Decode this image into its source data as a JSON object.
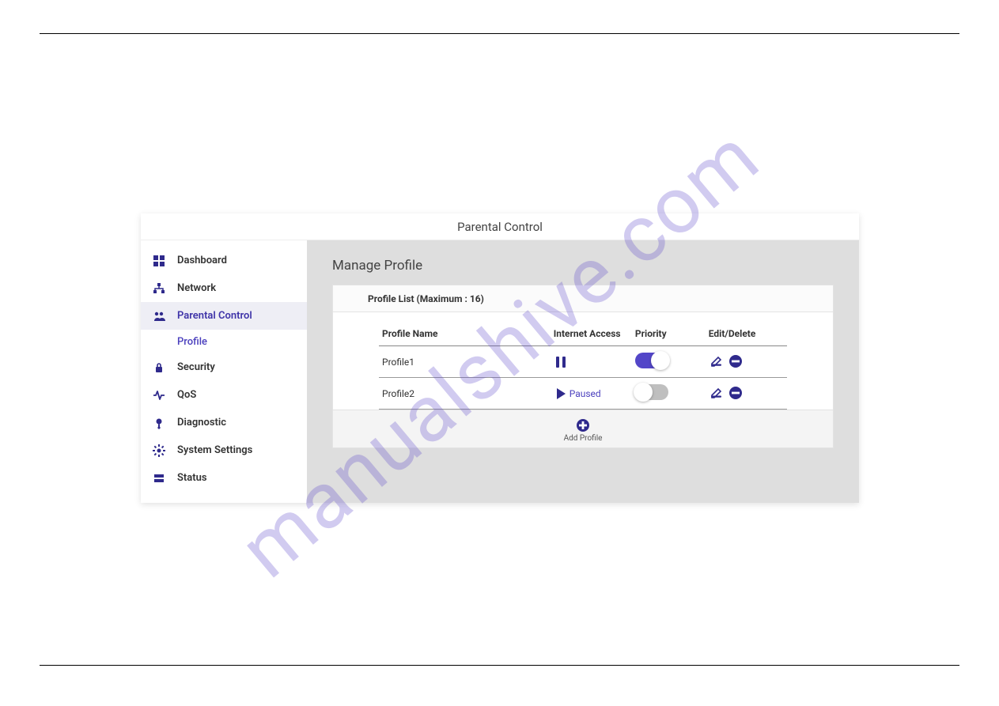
{
  "watermark": "manualshive.com",
  "page_title": "Parental Control",
  "sidebar": [
    {
      "icon": "dashboard",
      "label": "Dashboard",
      "active": false,
      "sub": false
    },
    {
      "icon": "network",
      "label": "Network",
      "active": false,
      "sub": false
    },
    {
      "icon": "parental",
      "label": "Parental Control",
      "active": true,
      "sub": false
    },
    {
      "icon": "",
      "label": "Profile",
      "active": false,
      "sub": true
    },
    {
      "icon": "security",
      "label": "Security",
      "active": false,
      "sub": false
    },
    {
      "icon": "qos",
      "label": "QoS",
      "active": false,
      "sub": false
    },
    {
      "icon": "diagnostic",
      "label": "Diagnostic",
      "active": false,
      "sub": false
    },
    {
      "icon": "settings",
      "label": "System Settings",
      "active": false,
      "sub": false
    },
    {
      "icon": "status",
      "label": "Status",
      "active": false,
      "sub": false
    }
  ],
  "section_title": "Manage Profile",
  "profile_list": {
    "header_label": "Profile List (Maximum : ",
    "max_count": "16",
    "header_close": ")",
    "columns": {
      "name": "Profile Name",
      "access": "Internet Access",
      "priority": "Priority",
      "actions": "Edit/Delete"
    },
    "rows": [
      {
        "name": "Profile1",
        "access_state": "playing",
        "paused_label": "",
        "priority_on": true
      },
      {
        "name": "Profile2",
        "access_state": "paused",
        "paused_label": "Paused",
        "priority_on": false
      }
    ],
    "add_label": "Add Profile"
  }
}
